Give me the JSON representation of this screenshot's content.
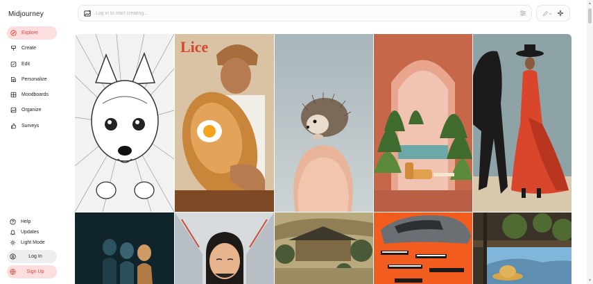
{
  "app": {
    "logo": "Midjourney"
  },
  "nav": {
    "items": [
      {
        "label": "Explore",
        "icon": "compass-icon",
        "active": true
      },
      {
        "label": "Create",
        "icon": "brush-icon",
        "active": false
      },
      {
        "label": "Edit",
        "icon": "edit-icon",
        "active": false
      },
      {
        "label": "Personalize",
        "icon": "personalize-icon",
        "active": false
      },
      {
        "label": "Moodboards",
        "icon": "moodboard-icon",
        "active": false
      },
      {
        "label": "Organize",
        "icon": "image-icon",
        "active": false
      },
      {
        "label": "Surveys",
        "icon": "thumbs-up-icon",
        "active": false
      }
    ]
  },
  "bottom": {
    "help": "Help",
    "updates": "Updates",
    "light_mode": "Light Mode",
    "login": "Log In",
    "signup": "Sign Up"
  },
  "prompt": {
    "placeholder": "Log in to start creating..."
  },
  "gallery": {
    "cover_text": "Lice"
  },
  "colors": {
    "accent": "#e4423a",
    "accent_bg": "#fcdede",
    "border": "#e6e6e6"
  }
}
